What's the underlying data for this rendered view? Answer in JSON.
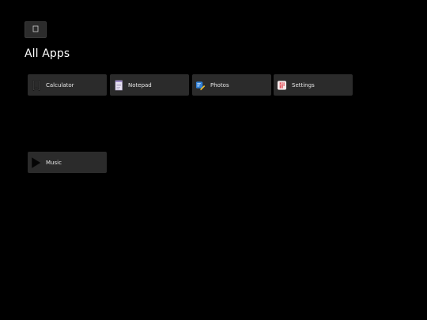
{
  "back_button": {
    "glyph": "",
    "icon": "back-icon"
  },
  "page_title": "All Apps",
  "apps": [
    {
      "label": "Calculator",
      "icon": "calculator-icon"
    },
    {
      "label": "Notepad",
      "icon": "notepad-icon"
    },
    {
      "label": "Photos",
      "icon": "photos-icon"
    },
    {
      "label": "Settings",
      "icon": "settings-icon"
    },
    {
      "label": "Music",
      "icon": "music-icon"
    }
  ],
  "colors": {
    "background": "#000000",
    "tile": "#2b2b2b",
    "text": "#ffffff"
  }
}
